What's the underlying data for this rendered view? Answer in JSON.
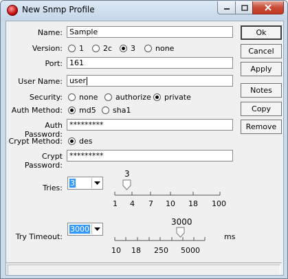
{
  "window": {
    "title": "New Snmp Profile"
  },
  "form": {
    "name": {
      "label": "Name:",
      "value": "Sample"
    },
    "version": {
      "label": "Version:",
      "options": [
        "1",
        "2c",
        "3",
        "none"
      ],
      "selected": "3"
    },
    "port": {
      "label": "Port:",
      "value": "161"
    },
    "user_name": {
      "label": "User Name:",
      "value": "user"
    },
    "security": {
      "label": "Security:",
      "options": [
        "none",
        "authorize",
        "private"
      ],
      "selected": "private"
    },
    "auth_method": {
      "label": "Auth Method:",
      "options": [
        "md5",
        "sha1"
      ],
      "selected": "md5"
    },
    "auth_password": {
      "label": "Auth Password:",
      "value": "*********"
    },
    "crypt_method": {
      "label": "Crypt Method:",
      "options": [
        "des"
      ],
      "selected": "des"
    },
    "crypt_password": {
      "label": "Crypt Password:",
      "value": "*********"
    },
    "tries": {
      "label": "Tries:",
      "value": "3",
      "slider_value": "3",
      "ticks": [
        "1",
        "4",
        "7",
        "10",
        "18",
        "100"
      ]
    },
    "try_timeout": {
      "label": "Try Timeout:",
      "value": "3000",
      "slider_value": "3000",
      "ticks": [
        "10",
        "18",
        "250",
        "5000"
      ],
      "unit": "ms"
    }
  },
  "buttons": {
    "ok": "Ok",
    "cancel": "Cancel",
    "apply": "Apply",
    "notes": "Notes",
    "copy": "Copy",
    "remove": "Remove"
  }
}
